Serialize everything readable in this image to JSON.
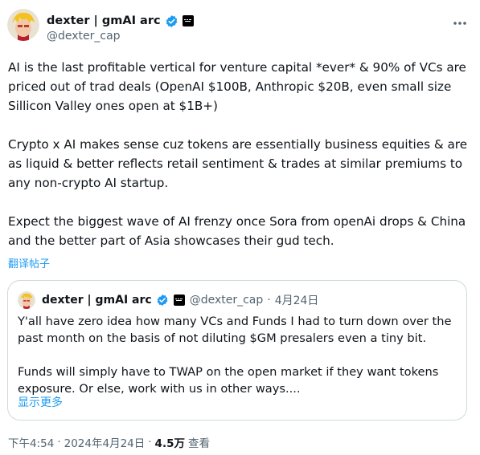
{
  "author": {
    "display_name": "dexter | gmAI arc",
    "handle": "@dexter_cap"
  },
  "tweet": {
    "paragraphs": [
      "AI is the last profitable vertical for venture capital *ever* & 90% of VCs are priced out of trad deals (OpenAI $100B, Anthropic $20B, even small size Sillicon Valley ones open at $1B+)",
      "Crypto x AI makes sense cuz tokens are essentially business equities & are as liquid & better reflects retail sentiment & trades at similar premiums to any non-crypto AI startup.",
      "Expect the biggest wave of AI frenzy once Sora from openAi drops & China and the better part of Asia showcases their gud tech."
    ],
    "translate_label": "翻译帖子"
  },
  "quote": {
    "display_name": "dexter | gmAI arc",
    "handle": "@dexter_cap",
    "separator": "·",
    "date": "4月24日",
    "paragraphs": [
      "Y'all have zero idea how many VCs and Funds I had to turn down over the past month on the basis of not diluting $GM presalers even a tiny bit.",
      "Funds will simply have to TWAP on the open market if they want tokens exposure. Or else, work with us in other ways...."
    ],
    "show_more_label": "显示更多"
  },
  "meta": {
    "time": "下午4:54",
    "separator": "·",
    "date": "2024年4月24日",
    "separator2": "·",
    "views_count": "4.5万",
    "views_label": "查看"
  },
  "icons": {
    "verified": "verified-badge-icon",
    "affiliation": "affiliation-badge-icon",
    "more": "more-options-icon"
  },
  "colors": {
    "accent": "#1d9bf0",
    "secondary_text": "#536471",
    "border": "#cfd9de"
  }
}
